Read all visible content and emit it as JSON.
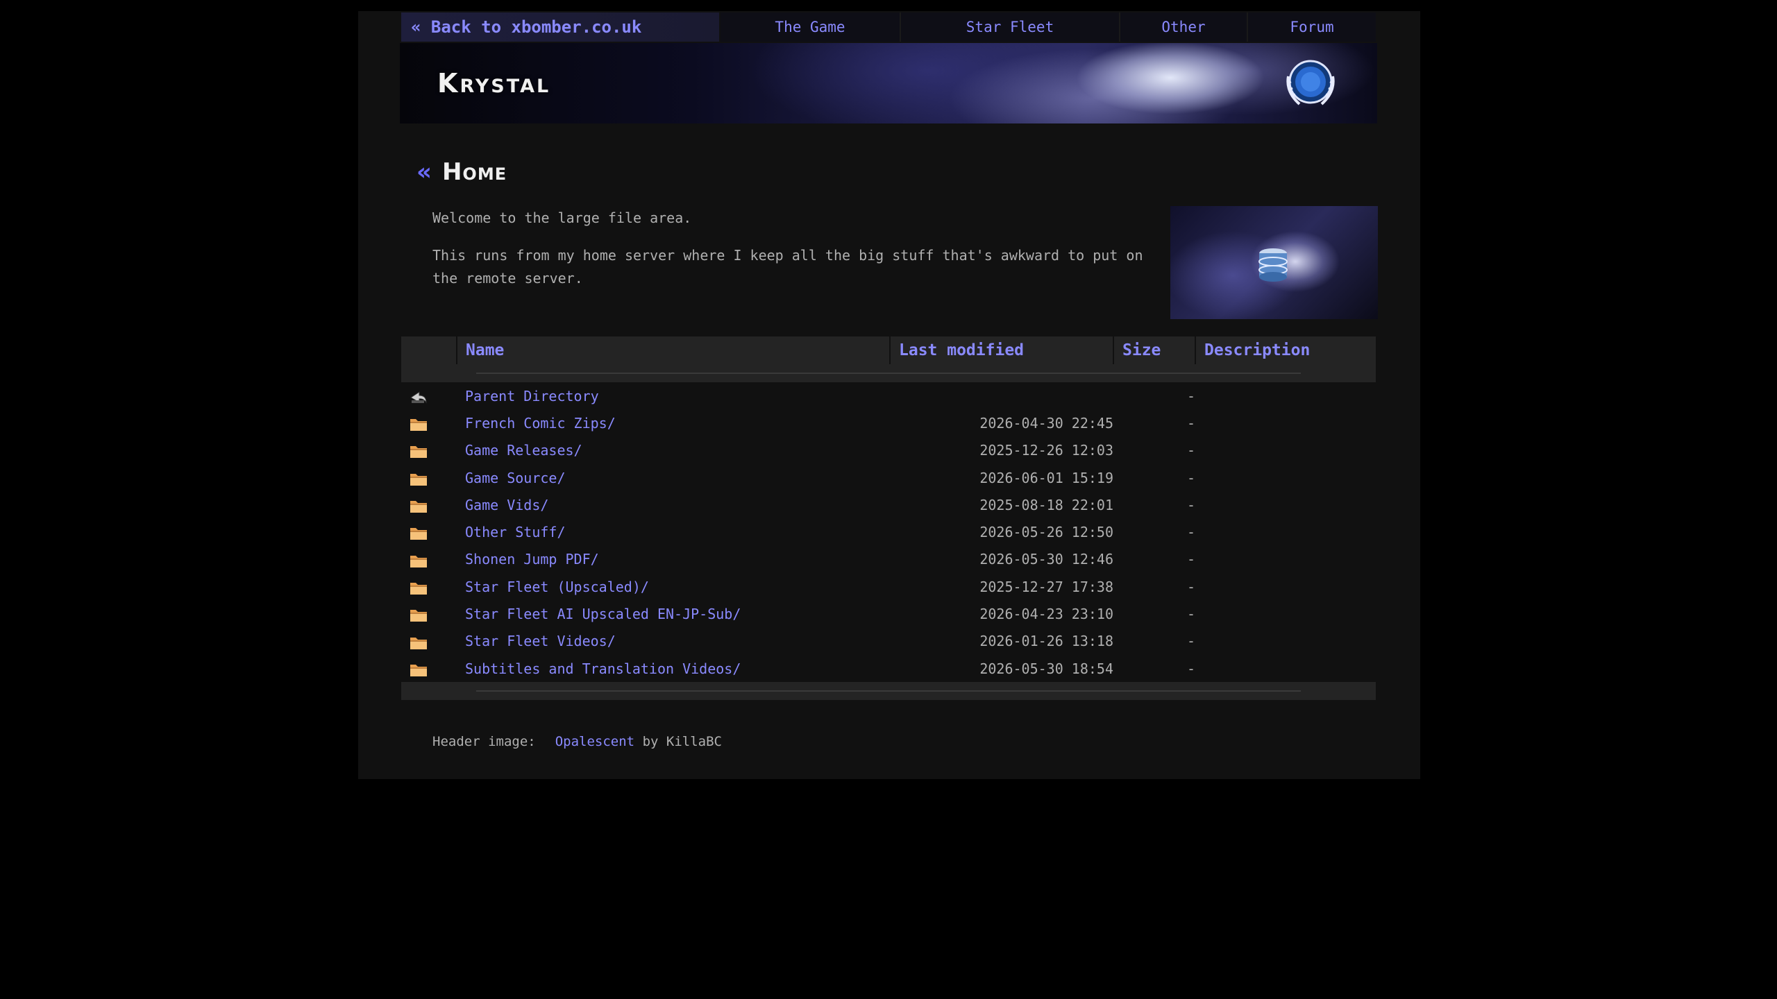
{
  "nav": {
    "back_label": "« Back to xbomber.co.uk",
    "items": [
      {
        "label": "The Game"
      },
      {
        "label": "Star Fleet"
      },
      {
        "label": "Other"
      },
      {
        "label": "Forum"
      }
    ]
  },
  "banner": {
    "logo_text": "Krystal"
  },
  "heading": {
    "arrow": "«",
    "title": "Home"
  },
  "intro": {
    "p1": "Welcome to the large file area.",
    "p2": "This runs from my home server where I keep all the big stuff that's awkward to put on the remote server."
  },
  "table": {
    "headers": {
      "name": "Name",
      "modified": "Last modified",
      "size": "Size",
      "description": "Description"
    },
    "rows": [
      {
        "icon": "back-arrow-icon",
        "name": "Parent Directory",
        "modified": "",
        "size": "-",
        "description": ""
      },
      {
        "icon": "folder-icon",
        "name": "French Comic Zips/",
        "modified": "2026-04-30 22:45",
        "size": "-",
        "description": ""
      },
      {
        "icon": "folder-icon",
        "name": "Game Releases/",
        "modified": "2025-12-26 12:03",
        "size": "-",
        "description": ""
      },
      {
        "icon": "folder-icon",
        "name": "Game Source/",
        "modified": "2026-06-01 15:19",
        "size": "-",
        "description": ""
      },
      {
        "icon": "folder-icon",
        "name": "Game Vids/",
        "modified": "2025-08-18 22:01",
        "size": "-",
        "description": ""
      },
      {
        "icon": "folder-icon",
        "name": "Other Stuff/",
        "modified": "2026-05-26 12:50",
        "size": "-",
        "description": ""
      },
      {
        "icon": "folder-icon",
        "name": "Shonen Jump PDF/",
        "modified": "2026-05-30 12:46",
        "size": "-",
        "description": ""
      },
      {
        "icon": "folder-icon",
        "name": "Star Fleet (Upscaled)/",
        "modified": "2025-12-27 17:38",
        "size": "-",
        "description": ""
      },
      {
        "icon": "folder-icon",
        "name": "Star Fleet AI Upscaled EN-JP-Sub/",
        "modified": "2026-04-23 23:10",
        "size": "-",
        "description": ""
      },
      {
        "icon": "folder-icon",
        "name": "Star Fleet Videos/",
        "modified": "2026-01-26 13:18",
        "size": "-",
        "description": ""
      },
      {
        "icon": "folder-icon",
        "name": "Subtitles and Translation Videos/",
        "modified": "2026-05-30 18:54",
        "size": "-",
        "description": ""
      }
    ]
  },
  "footer": {
    "label": "Header image:",
    "link": "Opalescent",
    "credit": "by KillaBC"
  }
}
